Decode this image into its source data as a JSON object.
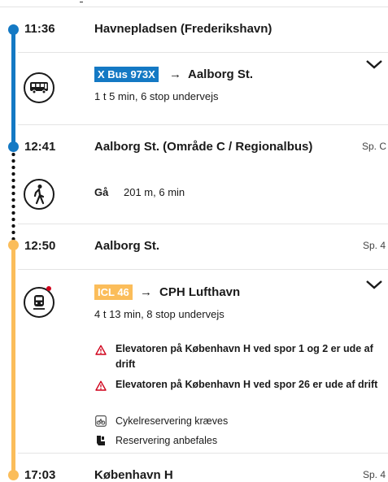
{
  "colors": {
    "bus_line": "#1479c4",
    "train_line": "#fbbd5a",
    "bus_badge": "#1479c4",
    "train_badge": "#fbbd5a",
    "warning": "#d0021b"
  },
  "stops": [
    {
      "time": "11:36",
      "name": "Havnepladsen (Frederikshavn)",
      "platform": ""
    },
    {
      "time": "12:41",
      "name": "Aalborg St. (Område C / Regionalbus)",
      "platform": "Sp. C"
    },
    {
      "time": "12:50",
      "name": "Aalborg St.",
      "platform": "Sp. 4"
    },
    {
      "time": "17:03",
      "name": "København H",
      "platform": "Sp. 4"
    }
  ],
  "legs": {
    "bus": {
      "icon": "bus-icon",
      "badge": "X Bus 973X",
      "arrow": "→",
      "destination": "Aalborg St.",
      "details": "1 t 5 min, 6 stop undervejs"
    },
    "walk": {
      "icon": "walking-person-icon",
      "label": "Gå",
      "details": "201 m, 6 min"
    },
    "train": {
      "icon": "train-icon",
      "badge": "ICL 46",
      "arrow": "→",
      "destination": "CPH Lufthavn",
      "details": "4 t 13 min, 8 stop undervejs",
      "notices": [
        "Elevatoren på København H ved spor 1 og 2 er ude af drift",
        "Elevatoren på København H ved spor 26 er ude af drift"
      ],
      "info": [
        {
          "icon": "bicycle-icon",
          "text": "Cykelreservering kræves"
        },
        {
          "icon": "seat-reservation-icon",
          "text": "Reservering anbefales"
        }
      ]
    }
  }
}
